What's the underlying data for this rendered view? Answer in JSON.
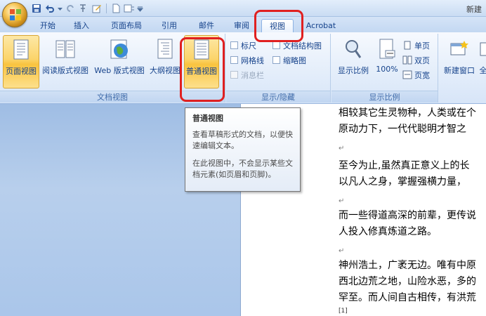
{
  "window": {
    "title": "新建"
  },
  "quick_access": [
    {
      "icon": "save-icon"
    },
    {
      "icon": "undo-icon"
    },
    {
      "icon": "redo-icon"
    },
    {
      "icon": "format-painter-icon"
    },
    {
      "icon": "edit-icon"
    },
    {
      "icon": "new-doc-icon"
    },
    {
      "icon": "layout-icon"
    },
    {
      "icon": "customize-dropdown-icon"
    }
  ],
  "tabs": [
    "开始",
    "插入",
    "页面布局",
    "引用",
    "邮件",
    "审阅",
    "视图",
    "Acrobat"
  ],
  "active_tab": "视图",
  "groups": {
    "doc_views": {
      "label": "文档视图",
      "buttons": [
        "页面视图",
        "阅读版式视图",
        "Web 版式视图",
        "大纲视图",
        "普通视图"
      ],
      "selected": "页面视图"
    },
    "show_hide": {
      "label": "显示/隐藏",
      "checks": [
        "标尺",
        "网格线",
        "消息栏",
        "文档结构图",
        "缩略图"
      ]
    },
    "zoom": {
      "label": "显示比例",
      "zoom_button": "显示比例",
      "percent": "100%",
      "one_page": "单页",
      "two_pages": "双页",
      "page_width": "页宽"
    },
    "window": {
      "new_window": "新建窗口",
      "all": "全"
    }
  },
  "tooltip": {
    "title": "普通视图",
    "line1": "查看草稿形式的文档，以便快速编辑文本。",
    "line2": "在此视图中，不会显示某些文档元素(如页眉和页脚)。"
  },
  "document": {
    "lines": [
      "相较其它生灵物种，人类或在个",
      "原动力下，一代代聪明才智之",
      "至今为止,虽然真正意义上的长",
      "以凡人之身，掌握强横力量，",
      "而一些得道高深的前辈，更传说",
      "人投入修真炼道之路。",
      "神州浩土，广袤无边。唯有中原",
      "西北边荒之地，山险水恶，多的",
      "罕至。而人间自古相传，有洪荒",
      "[1]"
    ],
    "paragraph_mark": "↵"
  },
  "colors": {
    "highlight": "#e02020",
    "selected_button": "#f9c340"
  }
}
